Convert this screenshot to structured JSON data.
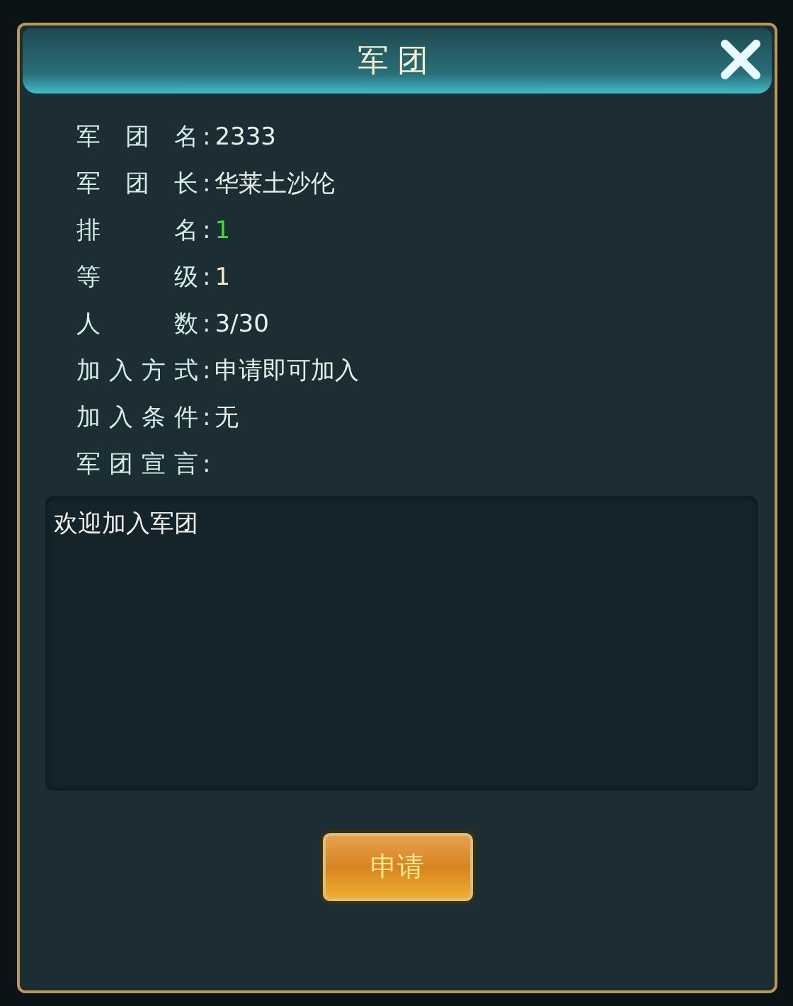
{
  "window": {
    "title": "军团"
  },
  "info_rows": [
    {
      "label": "军 团 名",
      "colon": ":",
      "value": "2333",
      "color": "#e8f0ea"
    },
    {
      "label": "军 团 长",
      "colon": ":",
      "value": "华莱土沙伦",
      "color": "#e8f0ea"
    },
    {
      "label": "排 名",
      "colon": ":",
      "value": "1",
      "color": "#3ee03a"
    },
    {
      "label": "等 级",
      "colon": ":",
      "value": "1",
      "color": "#f5ecc0"
    },
    {
      "label": "人 数",
      "colon": ":",
      "value": "3/30",
      "color": "#e8f0ea"
    },
    {
      "label": "加入方式",
      "colon": ":",
      "value": "申请即可加入",
      "color": "#e8f0ea"
    },
    {
      "label": "加入条件",
      "colon": ":",
      "value": "无",
      "color": "#e8f0ea"
    },
    {
      "label": "军团宣言",
      "colon": ":"
    }
  ],
  "motto": "欢迎加入军团",
  "apply_button": "申请"
}
